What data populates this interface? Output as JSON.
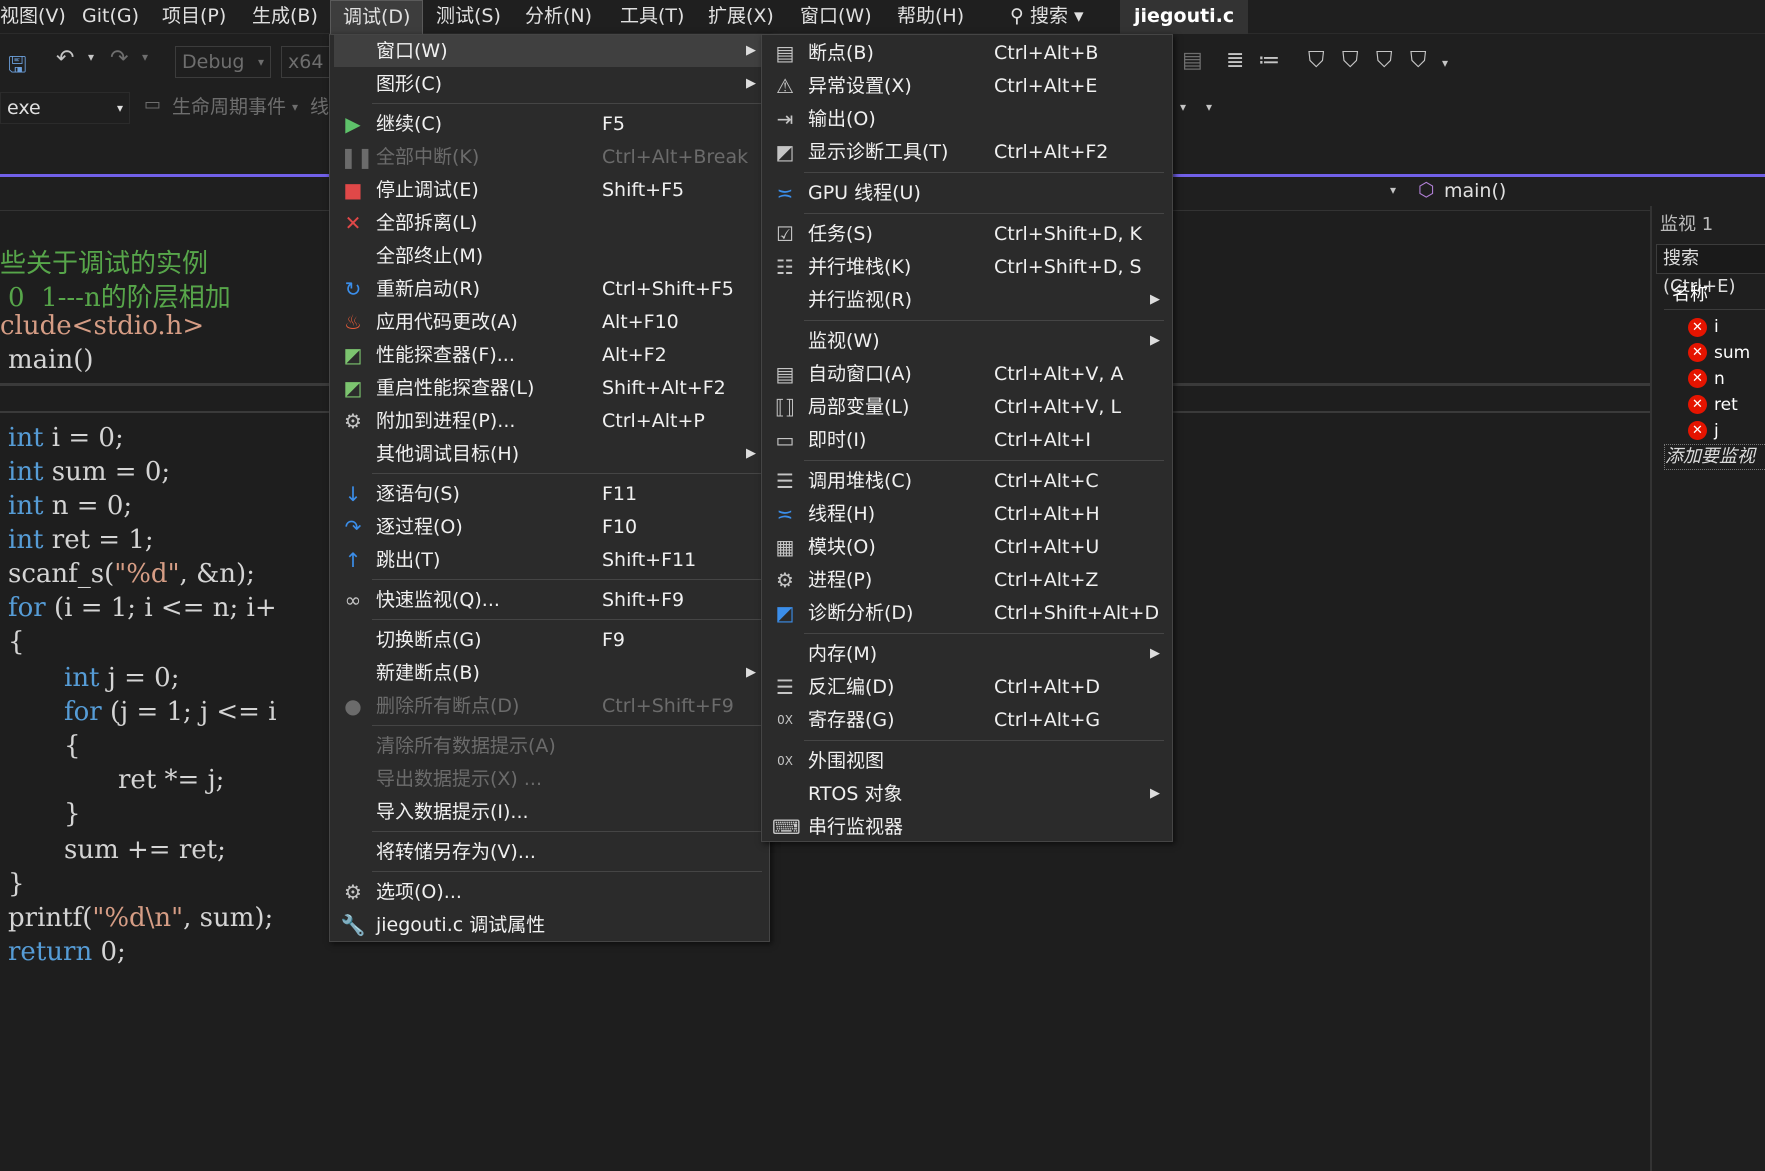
{
  "menubar": {
    "items": [
      "视图(V)",
      "Git(G)",
      "项目(P)",
      "生成(B)",
      "调试(D)",
      "测试(S)",
      "分析(N)",
      "工具(T)",
      "扩展(X)",
      "窗口(W)",
      "帮助(H)"
    ],
    "search_label": "搜索",
    "file_title": "jiegouti.c"
  },
  "toolbar": {
    "config": "Debug",
    "platform": "x64",
    "startup": "exe",
    "lifecycle": "生命周期事件",
    "thread": "线"
  },
  "navbar": {
    "function": "main()"
  },
  "code": {
    "comment1": "些关于调试的实例",
    "comment2": "0  1---n的阶层相加",
    "include": "clude<stdio.h>",
    "main": "main()",
    "l1": "int i = 0;",
    "l2": "int sum = 0;",
    "l3": "int n = 0;",
    "l4": "int ret = 1;",
    "l5": "scanf_s(\"%d\", &n);",
    "l6": "for (i = 1; i <= n; i+",
    "l7": "{",
    "l8": "int j = 0;",
    "l9": "for (j = 1; j <= i",
    "l10": "{",
    "l11": "ret *= j;",
    "l12": "}",
    "l13": "sum += ret;",
    "l14": "}",
    "l15": "printf(\"%d\\n\", sum);",
    "l16": "return 0;"
  },
  "watch": {
    "title": "监视 1",
    "search": "搜索(Ctrl+E)",
    "col_name": "名称",
    "rows": [
      "i",
      "sum",
      "n",
      "ret",
      "j"
    ],
    "add": "添加要监视"
  },
  "debug_menu": {
    "items": [
      {
        "label": "窗口(W)",
        "shortcut": ""
      },
      {
        "label": "图形(C)",
        "shortcut": ""
      },
      {
        "label": "继续(C)",
        "shortcut": "F5"
      },
      {
        "label": "全部中断(K)",
        "shortcut": "Ctrl+Alt+Break"
      },
      {
        "label": "停止调试(E)",
        "shortcut": "Shift+F5"
      },
      {
        "label": "全部拆离(L)",
        "shortcut": ""
      },
      {
        "label": "全部终止(M)",
        "shortcut": ""
      },
      {
        "label": "重新启动(R)",
        "shortcut": "Ctrl+Shift+F5"
      },
      {
        "label": "应用代码更改(A)",
        "shortcut": "Alt+F10"
      },
      {
        "label": "性能探查器(F)...",
        "shortcut": "Alt+F2"
      },
      {
        "label": "重启性能探查器(L)",
        "shortcut": "Shift+Alt+F2"
      },
      {
        "label": "附加到进程(P)...",
        "shortcut": "Ctrl+Alt+P"
      },
      {
        "label": "其他调试目标(H)",
        "shortcut": ""
      },
      {
        "label": "逐语句(S)",
        "shortcut": "F11"
      },
      {
        "label": "逐过程(O)",
        "shortcut": "F10"
      },
      {
        "label": "跳出(T)",
        "shortcut": "Shift+F11"
      },
      {
        "label": "快速监视(Q)...",
        "shortcut": "Shift+F9"
      },
      {
        "label": "切换断点(G)",
        "shortcut": "F9"
      },
      {
        "label": "新建断点(B)",
        "shortcut": ""
      },
      {
        "label": "删除所有断点(D)",
        "shortcut": "Ctrl+Shift+F9"
      },
      {
        "label": "清除所有数据提示(A)",
        "shortcut": ""
      },
      {
        "label": "导出数据提示(X) ...",
        "shortcut": ""
      },
      {
        "label": "导入数据提示(I)...",
        "shortcut": ""
      },
      {
        "label": "将转储另存为(V)...",
        "shortcut": ""
      },
      {
        "label": "选项(O)...",
        "shortcut": ""
      },
      {
        "label": "jiegouti.c 调试属性",
        "shortcut": ""
      }
    ]
  },
  "window_menu": {
    "items": [
      {
        "label": "断点(B)",
        "shortcut": "Ctrl+Alt+B"
      },
      {
        "label": "异常设置(X)",
        "shortcut": "Ctrl+Alt+E"
      },
      {
        "label": "输出(O)",
        "shortcut": ""
      },
      {
        "label": "显示诊断工具(T)",
        "shortcut": "Ctrl+Alt+F2"
      },
      {
        "label": "GPU 线程(U)",
        "shortcut": ""
      },
      {
        "label": "任务(S)",
        "shortcut": "Ctrl+Shift+D, K"
      },
      {
        "label": "并行堆栈(K)",
        "shortcut": "Ctrl+Shift+D, S"
      },
      {
        "label": "并行监视(R)",
        "shortcut": ""
      },
      {
        "label": "监视(W)",
        "shortcut": ""
      },
      {
        "label": "自动窗口(A)",
        "shortcut": "Ctrl+Alt+V, A"
      },
      {
        "label": "局部变量(L)",
        "shortcut": "Ctrl+Alt+V, L"
      },
      {
        "label": "即时(I)",
        "shortcut": "Ctrl+Alt+I"
      },
      {
        "label": "调用堆栈(C)",
        "shortcut": "Ctrl+Alt+C"
      },
      {
        "label": "线程(H)",
        "shortcut": "Ctrl+Alt+H"
      },
      {
        "label": "模块(O)",
        "shortcut": "Ctrl+Alt+U"
      },
      {
        "label": "进程(P)",
        "shortcut": "Ctrl+Alt+Z"
      },
      {
        "label": "诊断分析(D)",
        "shortcut": "Ctrl+Shift+Alt+D"
      },
      {
        "label": "内存(M)",
        "shortcut": ""
      },
      {
        "label": "反汇编(D)",
        "shortcut": "Ctrl+Alt+D"
      },
      {
        "label": "寄存器(G)",
        "shortcut": "Ctrl+Alt+G"
      },
      {
        "label": "外围视图",
        "shortcut": ""
      },
      {
        "label": "RTOS 对象",
        "shortcut": ""
      },
      {
        "label": "串行监视器",
        "shortcut": ""
      }
    ]
  },
  "colors": {
    "accent": "#7160e8",
    "menu_bg": "#2b2b2b",
    "error": "#e51400",
    "keyword": "#569cd6",
    "comment": "#57a64a"
  }
}
